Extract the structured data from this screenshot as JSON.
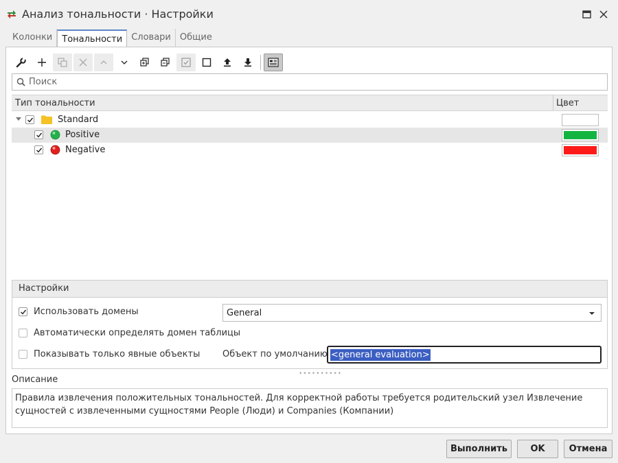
{
  "window": {
    "title": "Анализ тональности · Настройки",
    "icon": "sentiment-app-icon",
    "controls": [
      "maximize-icon",
      "close-icon"
    ]
  },
  "tabs": [
    {
      "label": "Колонки",
      "active": false
    },
    {
      "label": "Тональности",
      "active": true
    },
    {
      "label": "Словари",
      "active": false
    },
    {
      "label": "Общие",
      "active": false
    }
  ],
  "toolbar": {
    "buttons": [
      "wrench-icon",
      "plus-icon",
      "copy-icon",
      "delete-icon",
      "move-up-icon",
      "move-down-icon",
      "expand-all-icon",
      "collapse-all-icon",
      "check-all-icon",
      "uncheck-all-icon",
      "import-icon",
      "export-icon",
      "view-toggle-icon"
    ]
  },
  "search": {
    "placeholder": "Поиск",
    "value": ""
  },
  "grid": {
    "columns": [
      "Тип тональности",
      "Цвет"
    ],
    "rows": [
      {
        "label": "Standard",
        "checked": true,
        "expanded": true,
        "icon": "folder-icon",
        "color": "#ffffff",
        "level": 0
      },
      {
        "label": "Positive",
        "checked": true,
        "icon": "green-dot-icon",
        "color": "#13b540",
        "level": 1,
        "selected": true
      },
      {
        "label": "Negative",
        "checked": true,
        "icon": "red-dot-icon",
        "color": "#ff1a1a",
        "level": 1
      }
    ]
  },
  "settings": {
    "header": "Настройки",
    "use_domains": {
      "label": "Использовать домены",
      "checked": true
    },
    "domain_select": {
      "value": "General"
    },
    "auto_domain": {
      "label": "Автоматически определять домен таблицы",
      "checked": false
    },
    "explicit_only": {
      "label": "Показывать только явные объекты",
      "checked": false
    },
    "default_object": {
      "label": "Объект по умолчанию",
      "value": "<general evaluation>"
    }
  },
  "description": {
    "label": "Описание",
    "text": "Правила извлечения положительных тональностей. Для корректной работы требуется родительский узел Извлечение сущностей с извлеченными сущностями People (Люди) и Companies (Компании)"
  },
  "footer": {
    "run_label": "Выполнить",
    "ok_label": "OK",
    "cancel_label": "Отмена"
  },
  "colors": {
    "accent": "#5b87c8",
    "selection": "#3b5ec2",
    "positive": "#13b540",
    "negative": "#ff1a1a",
    "folder": "#f5c226"
  }
}
